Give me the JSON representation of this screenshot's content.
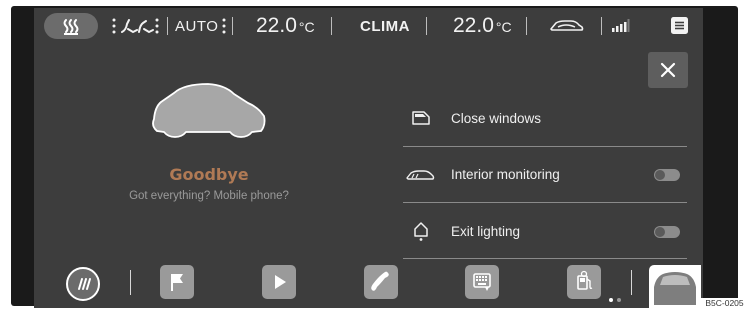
{
  "topbar": {
    "auto_label": "AUTO",
    "temp_left": "22.0",
    "temp_left_unit": "°C",
    "clima_label": "CLIMA",
    "temp_right": "22.0",
    "temp_right_unit": "°C",
    "icons": [
      "seat-heating-icon",
      "airflow-distribution-icon",
      "car-recirculation-icon",
      "signal-strength-icon",
      "menu-icon"
    ]
  },
  "car_panel": {
    "title": "Goodbye",
    "subtitle": "Got everything? Mobile phone?"
  },
  "options": [
    {
      "label": "Close windows",
      "icon": "window-icon",
      "toggle": null
    },
    {
      "label": "Interior monitoring",
      "icon": "interior-monitoring-icon",
      "toggle": "off"
    },
    {
      "label": "Exit lighting",
      "icon": "exit-lighting-icon",
      "toggle": "off"
    }
  ],
  "dock": {
    "icons": [
      "rear-window-heater-icon",
      "flag-icon",
      "play-icon",
      "phone-icon",
      "keypad-icon",
      "fuel-icon",
      "vehicle-icon"
    ],
    "page_indicator": {
      "pages": 2,
      "active": 1
    }
  },
  "reference_code": "B5C-0205",
  "colors": {
    "accent": "#b07a55",
    "background": "#3d3d3d",
    "toggle_off": "#8c8c8c"
  }
}
